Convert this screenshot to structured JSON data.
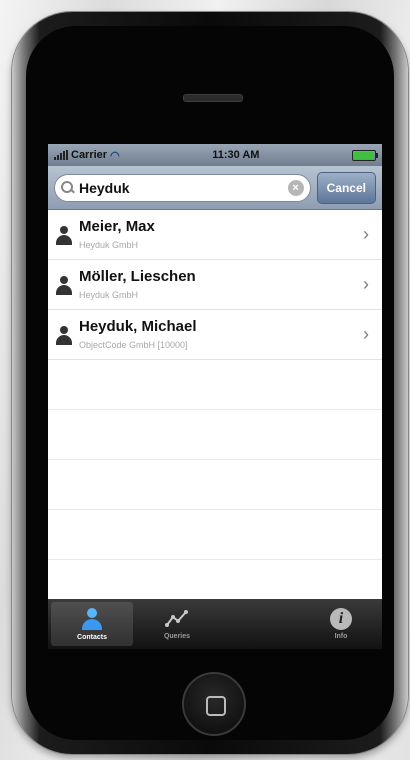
{
  "status": {
    "carrier": "Carrier",
    "time": "11:30 AM"
  },
  "search": {
    "value": "Heyduk",
    "cancel_label": "Cancel"
  },
  "results": [
    {
      "name": "Meier, Max",
      "company": "Heyduk GmbH"
    },
    {
      "name": "Möller, Lieschen",
      "company": "Heyduk GmbH"
    },
    {
      "name": "Heyduk, Michael",
      "company": "ObjectCode GmbH [10000]"
    }
  ],
  "tabs": [
    {
      "label": "Contacts",
      "icon": "contacts-icon",
      "active": true
    },
    {
      "label": "Queries",
      "icon": "queries-icon",
      "active": false
    },
    {
      "label": "Info",
      "icon": "info-icon",
      "active": false
    }
  ],
  "colors": {
    "accent": "#3a98f0",
    "cancel": "#5d7597"
  }
}
